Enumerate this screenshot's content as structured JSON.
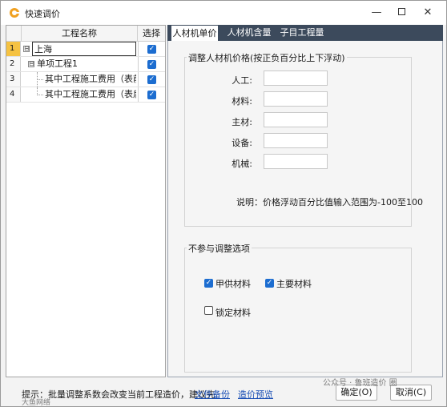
{
  "window": {
    "title": "快速调价",
    "minimize_glyph": "—",
    "close_glyph": "✕"
  },
  "tree": {
    "columns": {
      "name": "工程名称",
      "select": "选择"
    },
    "rows": [
      {
        "num": "1",
        "name": "上海",
        "toggle": "⊟",
        "checked": true
      },
      {
        "num": "2",
        "name": "单项工程1",
        "toggle": "⊟",
        "checked": true
      },
      {
        "num": "3",
        "name": "其中工程施工费用（表前",
        "checked": true
      },
      {
        "num": "4",
        "name": "其中工程施工费用（表后",
        "checked": true
      }
    ]
  },
  "tabs": [
    "人材机单价",
    "人材机含量",
    "子目工程量"
  ],
  "price_group": {
    "title": "调整人材机价格(按正负百分比上下浮动)",
    "fields": [
      {
        "label": "人工:",
        "value": ""
      },
      {
        "label": "材料:",
        "value": ""
      },
      {
        "label": "主材:",
        "value": ""
      },
      {
        "label": "设备:",
        "value": ""
      },
      {
        "label": "机械:",
        "value": ""
      }
    ],
    "note": "说明：价格浮动百分比值输入范围为-100至100"
  },
  "exclude_group": {
    "title": "不参与调整选项",
    "options": [
      {
        "label": "甲供材料",
        "checked": true
      },
      {
        "label": "主要材料",
        "checked": true
      },
      {
        "label": "锁定材料",
        "checked": false
      }
    ]
  },
  "status": {
    "hint": "提示：批量调整系数会改变当前工程造价，建议先",
    "backup_link": "文件备份",
    "preview_link": "造价预览"
  },
  "buttons": {
    "ok": "确定(O)",
    "cancel": "取消(C)"
  },
  "watermarks": {
    "left": "大鱼网络",
    "right": "公众号 · 鲁班造价 圈"
  },
  "colors": {
    "accent": "#1c6dd0",
    "tab_bar": "#3c4a5c",
    "active_row": "#f5c242"
  }
}
